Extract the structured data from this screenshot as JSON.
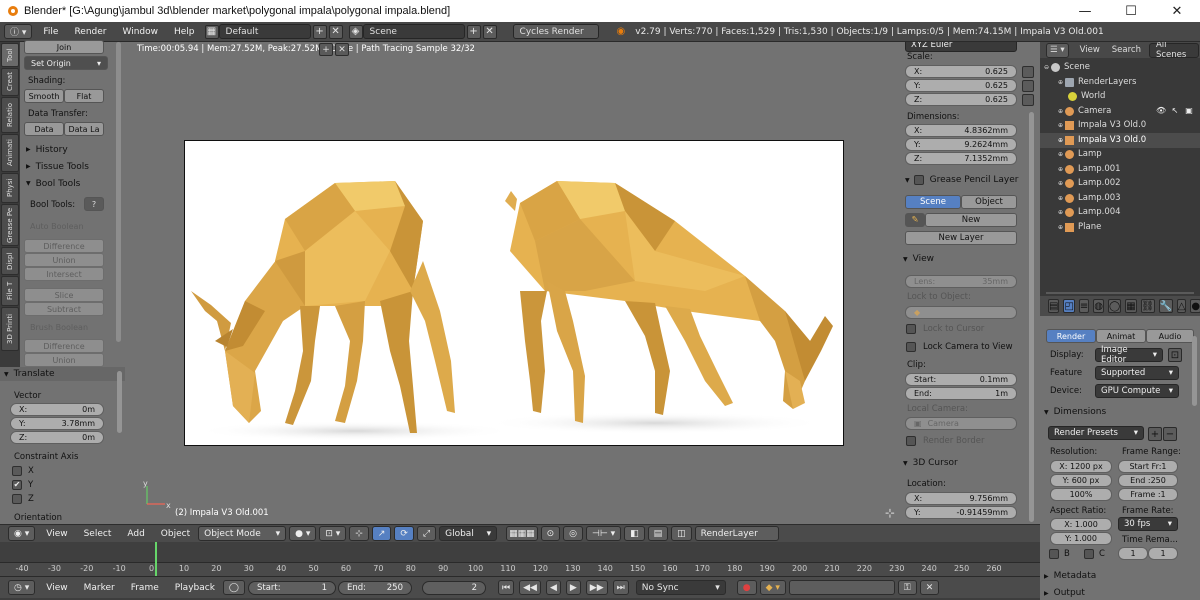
{
  "window": {
    "title": "Blender* [G:\\Agung\\jambul 3d\\blender market\\polygonal impala\\polygonal impala.blend]",
    "min": "—",
    "max": "☐",
    "close": "✕"
  },
  "info_header": {
    "menus": [
      "File",
      "Render",
      "Window",
      "Help"
    ],
    "layout": "Default",
    "scene": "Scene",
    "engine": "Cycles Render",
    "stats": "v2.79 | Verts:770 | Faces:1,529 | Tris:1,530 | Objects:1/9 | Lamps:0/5 | Mem:74.15M | Impala V3 Old.001"
  },
  "tool_tabs": [
    "Tool",
    "Creat",
    "Relatio",
    "Animati",
    "Physi",
    "Grease Pe",
    "Displ",
    "File T",
    "3D Printi"
  ],
  "tool_shelf": {
    "join": "Join",
    "set_origin": "Set Origin",
    "shading_label": "Shading:",
    "smooth": "Smooth",
    "flat": "Flat",
    "data_transfer_label": "Data Transfer:",
    "data": "Data",
    "data_layout": "Data La",
    "history": "History",
    "tissue_tools": "Tissue Tools",
    "bool_tools": "Bool Tools",
    "bool_tools_label": "Bool Tools:",
    "auto_boolean": "Auto Boolean",
    "difference": "Difference",
    "union": "Union",
    "intersect": "Intersect",
    "slice": "Slice",
    "subtract": "Subtract",
    "brush_boolean": "Brush Boolean",
    "difference2": "Difference",
    "union2": "Union"
  },
  "operator": {
    "title": "Translate",
    "vector_label": "Vector",
    "x_label": "X:",
    "x": "0m",
    "y_label": "Y:",
    "y": "3.78mm",
    "z_label": "Z:",
    "z": "0m",
    "constraint_label": "Constraint Axis",
    "axis_x": "X",
    "axis_y": "Y",
    "axis_z": "Z",
    "orientation_label": "Orientation",
    "checked_mark": "✔"
  },
  "viewport": {
    "render_info": "Time:00:05.94 | Mem:27.52M, Peak:27.52M | Done | Path Tracing Sample 32/32",
    "object_label": "(2) Impala V3 Old.001",
    "axis_y": "y",
    "axis_x": "x"
  },
  "viewport_header": {
    "view": "View",
    "select": "Select",
    "add": "Add",
    "object": "Object",
    "mode": "Object Mode",
    "orientation": "Global",
    "render_layer": "RenderLayer"
  },
  "timeline": {
    "ticks": [
      "-40",
      "-30",
      "-20",
      "-10",
      "0",
      "10",
      "20",
      "30",
      "40",
      "50",
      "60",
      "70",
      "80",
      "90",
      "100",
      "110",
      "120",
      "130",
      "140",
      "150",
      "160",
      "170",
      "180",
      "190",
      "200",
      "210",
      "220",
      "230",
      "240",
      "250",
      "260"
    ],
    "current_frame": 2,
    "view": "View",
    "marker": "Marker",
    "frame": "Frame",
    "playback": "Playback",
    "start_label": "Start:",
    "start": "1",
    "end_label": "End:",
    "end": "250",
    "current": "2",
    "sync": "No Sync"
  },
  "n_panel": {
    "rot_mode": "XYZ Euler",
    "scale_label": "Scale:",
    "scale_x_label": "X:",
    "scale_x": "0.625",
    "scale_y_label": "Y:",
    "scale_y": "0.625",
    "scale_z_label": "Z:",
    "scale_z": "0.625",
    "dims_label": "Dimensions:",
    "dim_x_label": "X:",
    "dim_x": "4.8362mm",
    "dim_y_label": "Y:",
    "dim_y": "9.2624mm",
    "dim_z_label": "Z:",
    "dim_z": "7.1352mm",
    "grease_pencil": "Grease Pencil Layer",
    "scene_btn": "Scene",
    "object_btn": "Object",
    "new_btn": "New",
    "new_layer": "New Layer",
    "view_panel": "View",
    "lens_label": "Lens:",
    "lens": "35mm",
    "lock_object": "Lock to Object:",
    "lock_cursor": "Lock to Cursor",
    "lock_camera": "Lock Camera to View",
    "clip_label": "Clip:",
    "clip_start_label": "Start:",
    "clip_start": "0.1mm",
    "clip_end_label": "End:",
    "clip_end": "1m",
    "local_camera": "Local Camera:",
    "camera": "Camera",
    "render_border": "Render Border",
    "cursor_panel": "3D Cursor",
    "location_label": "Location:",
    "loc_x_label": "X:",
    "loc_x": "9.756mm",
    "loc_y_label": "Y:",
    "loc_y": "-0.91459mm"
  },
  "outliner": {
    "view": "View",
    "search": "Search",
    "filter": "All Scenes",
    "rows": [
      {
        "name": "Scene",
        "color": "#c8c8c8"
      },
      {
        "name": "RenderLayers",
        "color": "#9ea6b0"
      },
      {
        "name": "World",
        "color": "#d8d23a"
      },
      {
        "name": "Camera",
        "color": "#e09a55"
      },
      {
        "name": "Impala V3 Old.0",
        "color": "#e09a55"
      },
      {
        "name": "Impala V3 Old.0",
        "color": "#e09a55"
      },
      {
        "name": "Lamp",
        "color": "#e09a55"
      },
      {
        "name": "Lamp.001",
        "color": "#e09a55"
      },
      {
        "name": "Lamp.002",
        "color": "#e09a55"
      },
      {
        "name": "Lamp.003",
        "color": "#e09a55"
      },
      {
        "name": "Lamp.004",
        "color": "#e09a55"
      },
      {
        "name": "Plane",
        "color": "#e09a55"
      }
    ]
  },
  "properties": {
    "tab_render": "Render",
    "tab_anim": "Animat",
    "tab_audio": "Audio",
    "display_label": "Display:",
    "display": "Image Editor",
    "feature_label": "Feature",
    "feature": "Supported",
    "device_label": "Device:",
    "device": "GPU Compute",
    "dimensions": "Dimensions",
    "presets": "Render Presets",
    "resolution_label": "Resolution:",
    "res_x": "X: 1200 px",
    "res_y": "Y: 600 px",
    "res_pct": "100%",
    "frame_range_label": "Frame Range:",
    "start_fr": "Start Fr:1",
    "end_fr": "End :250",
    "frame_step": "Frame :1",
    "aspect_label": "Aspect Ratio:",
    "asp_x": "X:  1.000",
    "asp_y": "Y:  1.000",
    "frame_rate_label": "Frame Rate:",
    "fps": "30 fps",
    "time_remap": "Time Rema...",
    "remap_old": "1",
    "remap_new": "1",
    "b_label": "B",
    "c_label": "C",
    "metadata": "Metadata",
    "output": "Output"
  },
  "colors": {
    "accent": "#5680c2",
    "impala_fill": "#e6b250",
    "viewport_bg": "#727272"
  }
}
